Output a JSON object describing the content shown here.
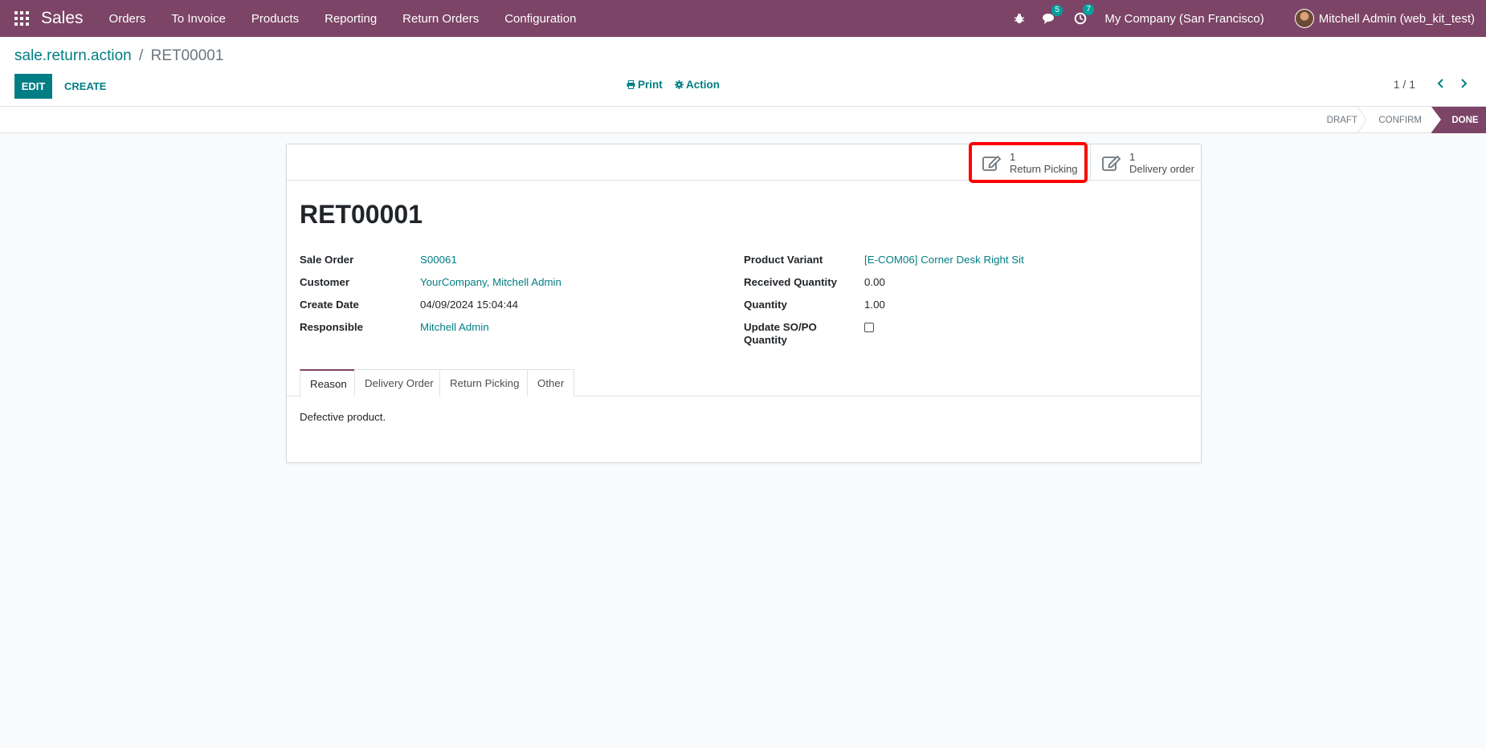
{
  "navbar": {
    "app_name": "Sales",
    "menu": [
      "Orders",
      "To Invoice",
      "Products",
      "Reporting",
      "Return Orders",
      "Configuration"
    ],
    "messages_count": "5",
    "activities_count": "7",
    "company": "My Company (San Francisco)",
    "user": "Mitchell Admin (web_kit_test)"
  },
  "breadcrumb": {
    "parent": "sale.return.action",
    "separator": "/",
    "current": "RET00001"
  },
  "toolbar": {
    "edit_label": "EDIT",
    "create_label": "CREATE",
    "print_label": "Print",
    "action_label": "Action",
    "pager": "1 / 1"
  },
  "status": {
    "stages": [
      "DRAFT",
      "CONFIRM",
      "DONE"
    ],
    "current": "DONE"
  },
  "smart_buttons": {
    "return_picking": {
      "value": "1",
      "label": "Return Picking"
    },
    "delivery_order": {
      "value": "1",
      "label": "Delivery order"
    }
  },
  "record": {
    "title": "RET00001",
    "left_fields": [
      {
        "label": "Sale Order",
        "value": "S00061"
      },
      {
        "label": "Customer",
        "value": "YourCompany, Mitchell Admin"
      },
      {
        "label": "Create Date",
        "value": "04/09/2024 15:04:44"
      },
      {
        "label": "Responsible",
        "value": "Mitchell Admin"
      }
    ],
    "right_fields": [
      {
        "label": "Product Variant",
        "value": "[E-COM06] Corner Desk Right Sit"
      },
      {
        "label": "Received Quantity",
        "value": "0.00"
      },
      {
        "label": "Quantity",
        "value": "1.00"
      },
      {
        "label": "Update SO/PO Quantity",
        "value": ""
      }
    ]
  },
  "tabs": {
    "items": [
      "Reason",
      "Delivery Order",
      "Return Picking",
      "Other"
    ],
    "active": "Reason",
    "content": "Defective product."
  },
  "colors": {
    "brand": "#7c4466",
    "accent": "#017e84",
    "badge": "#00a09d",
    "highlight": "#ff0000"
  }
}
